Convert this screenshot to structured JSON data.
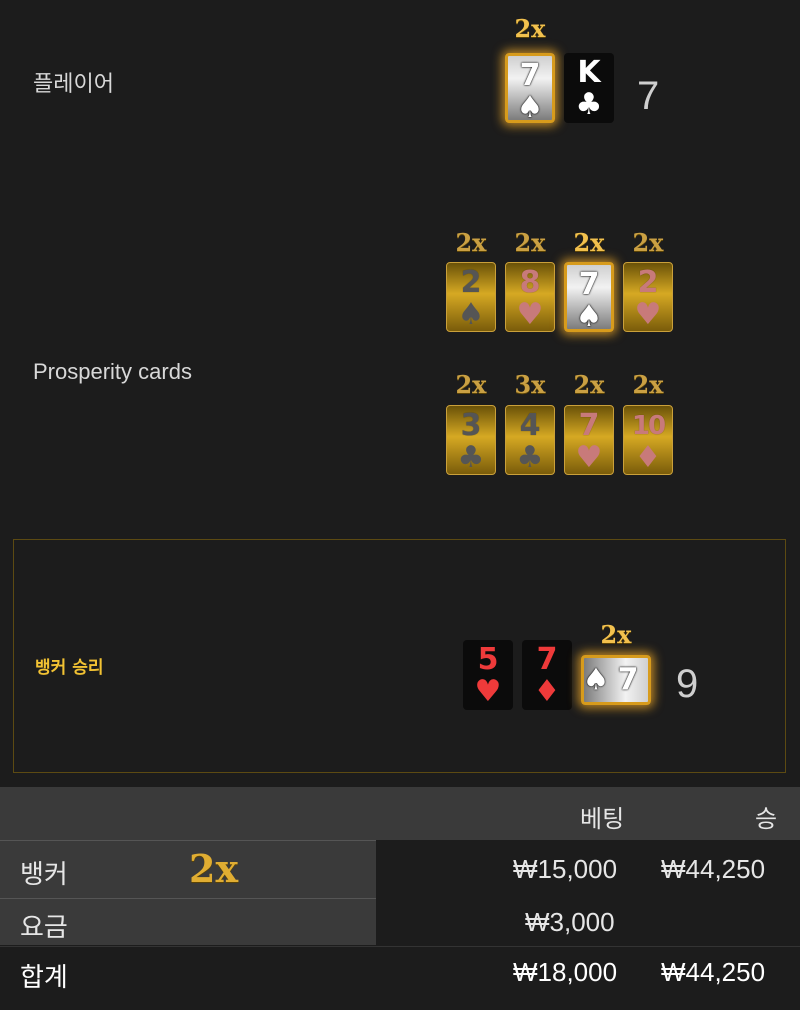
{
  "player": {
    "label": "플레이어",
    "total": "7",
    "cards": [
      {
        "rank": "7",
        "suit": "♠",
        "multiplier": "2x",
        "highlight": true
      },
      {
        "rank": "K",
        "suit": "♣",
        "multiplier": "",
        "highlight": false
      }
    ]
  },
  "prosperity": {
    "label": "Prosperity cards",
    "row1": [
      {
        "rank": "2",
        "suit": "♠",
        "multiplier": "2x",
        "color": "black",
        "highlight": false
      },
      {
        "rank": "8",
        "suit": "♥",
        "multiplier": "2x",
        "color": "red",
        "highlight": false
      },
      {
        "rank": "7",
        "suit": "♠",
        "multiplier": "2x",
        "color": "black",
        "highlight": true
      },
      {
        "rank": "2",
        "suit": "♥",
        "multiplier": "2x",
        "color": "red",
        "highlight": false
      }
    ],
    "row2": [
      {
        "rank": "3",
        "suit": "♣",
        "multiplier": "2x",
        "color": "black",
        "highlight": false
      },
      {
        "rank": "4",
        "suit": "♣",
        "multiplier": "3x",
        "color": "black",
        "highlight": false
      },
      {
        "rank": "7",
        "suit": "♥",
        "multiplier": "2x",
        "color": "red",
        "highlight": false
      },
      {
        "rank": "10",
        "suit": "♦",
        "multiplier": "2x",
        "color": "red",
        "highlight": false
      }
    ]
  },
  "banker": {
    "label": "뱅커 승리",
    "total": "9",
    "cards": [
      {
        "rank": "5",
        "suit": "♥",
        "multiplier": ""
      },
      {
        "rank": "7",
        "suit": "♦",
        "multiplier": ""
      },
      {
        "rank": "7",
        "suit": "♠",
        "multiplier": "2x"
      }
    ]
  },
  "table": {
    "header": {
      "bet": "베팅",
      "win": "승"
    },
    "rows": [
      {
        "label": "뱅커",
        "multiplier": "2x",
        "bet": "₩15,000",
        "win": "₩44,250"
      },
      {
        "label": "요금",
        "bet": "₩3,000",
        "win": ""
      },
      {
        "label": "합계",
        "bet": "₩18,000",
        "win": "₩44,250"
      }
    ]
  },
  "colors": {
    "gold": "#d6a923",
    "highlight_border": "#d79b1c",
    "winner_label": "#f2c233",
    "red_suit": "#ee3a3a"
  }
}
